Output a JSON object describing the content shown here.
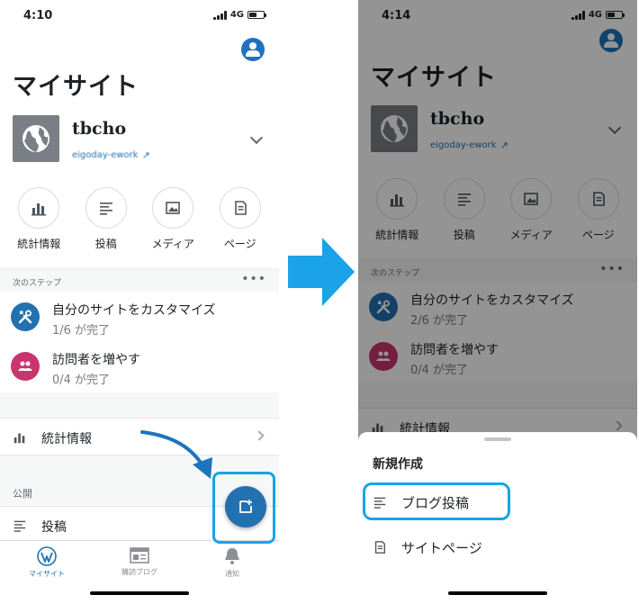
{
  "colors": {
    "accent": "#2271b1",
    "highlight": "#1aa3e8",
    "task_blue": "#2271b1",
    "task_pink": "#c9356e"
  },
  "left": {
    "status": {
      "time": "4:10",
      "network": "4G"
    },
    "title": "マイサイト",
    "site": {
      "name": "tbcho",
      "url": "eigoday-ework"
    },
    "quick_actions": [
      {
        "label": "統計情報",
        "icon": "bar-chart-icon"
      },
      {
        "label": "投稿",
        "icon": "posts-icon"
      },
      {
        "label": "メディア",
        "icon": "image-icon"
      },
      {
        "label": "ページ",
        "icon": "page-icon"
      }
    ],
    "next_steps": {
      "label": "次のステップ",
      "more": "•••",
      "tasks": [
        {
          "title": "自分のサイトをカスタマイズ",
          "progress": "1/6 が完了"
        },
        {
          "title": "訪問者を増やす",
          "progress": "0/4 が完了"
        }
      ]
    },
    "stats_row": "統計情報",
    "publish_label": "公開",
    "posts_row": "投稿",
    "tabs": [
      {
        "label": "マイサイト",
        "icon": "wordpress-icon"
      },
      {
        "label": "購読ブログ",
        "icon": "reader-icon"
      },
      {
        "label": "通知",
        "icon": "bell-icon"
      }
    ]
  },
  "right": {
    "status": {
      "time": "4:14",
      "network": "4G"
    },
    "title": "マイサイト",
    "site": {
      "name": "tbcho",
      "url": "eigoday-ework"
    },
    "quick_actions": [
      {
        "label": "統計情報",
        "icon": "bar-chart-icon"
      },
      {
        "label": "投稿",
        "icon": "posts-icon"
      },
      {
        "label": "メディア",
        "icon": "image-icon"
      },
      {
        "label": "ページ",
        "icon": "page-icon"
      }
    ],
    "next_steps": {
      "label": "次のステップ",
      "more": "•••",
      "tasks": [
        {
          "title": "自分のサイトをカスタマイズ",
          "progress": "2/6 が完了"
        },
        {
          "title": "訪問者を増やす",
          "progress": "0/4 が完了"
        }
      ]
    },
    "stats_row": "統計情報",
    "sheet": {
      "title": "新規作成",
      "items": [
        {
          "label": "ブログ投稿",
          "icon": "posts-icon"
        },
        {
          "label": "サイトページ",
          "icon": "page-icon"
        }
      ]
    }
  }
}
